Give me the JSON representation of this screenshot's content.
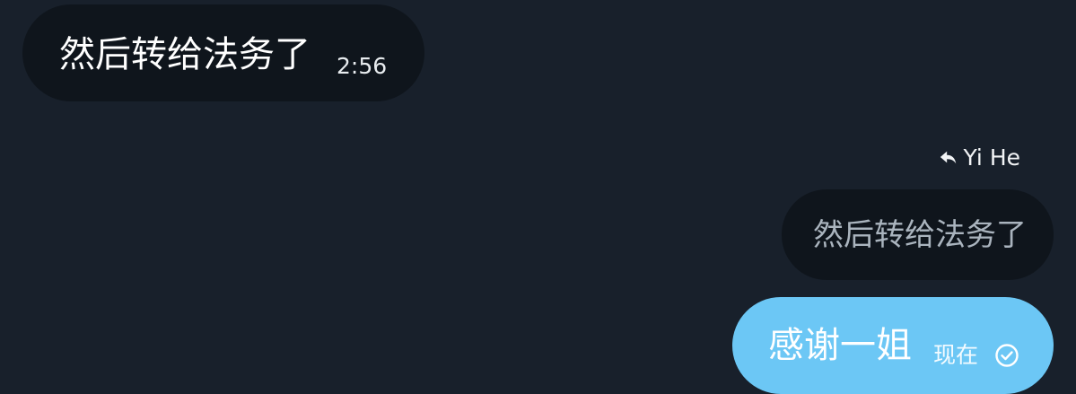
{
  "colors": {
    "background": "#18202b",
    "incoming_bubble": "#0f151c",
    "outgoing_bubble": "#6cc7f5",
    "quote_text": "#aab4be"
  },
  "messages": {
    "incoming": {
      "text": "然后转给法务了",
      "time": "2:56"
    },
    "reply": {
      "icon": "reply-arrow-icon",
      "to_name": "Yi He",
      "quoted_text": "然后转给法务了"
    },
    "outgoing": {
      "text": "感谢一姐",
      "time": "现在",
      "status_icon": "check-circle-icon"
    }
  }
}
